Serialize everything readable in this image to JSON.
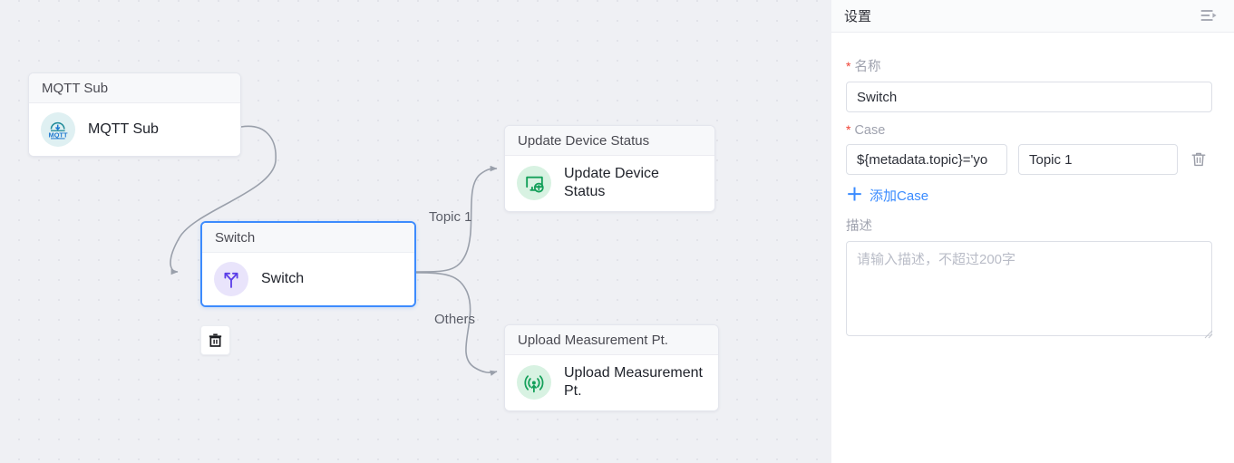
{
  "canvas": {
    "nodes": [
      {
        "id": "mqtt-sub",
        "header": "MQTT Sub",
        "label": "MQTT Sub",
        "icon": "mqtt-sub-icon",
        "icon_color": "#1f8a99",
        "icon_bg": "#dff0f2",
        "selected": false
      },
      {
        "id": "switch",
        "header": "Switch",
        "label": "Switch",
        "icon": "switch-branch-icon",
        "icon_color": "#5b3ee8",
        "icon_bg": "#e9e4fb",
        "selected": true
      },
      {
        "id": "update-device-status",
        "header": "Update Device Status",
        "label": "Update Device Status",
        "icon": "update-device-status-icon",
        "icon_color": "#14a05a",
        "icon_bg": "#d8f2e2",
        "selected": false
      },
      {
        "id": "upload-measurement-pt",
        "header": "Upload Measurement Pt.",
        "label": "Upload Measurement Pt.",
        "icon": "upload-measurement-icon",
        "icon_color": "#14a05a",
        "icon_bg": "#d8f2e2",
        "selected": false
      }
    ],
    "edge_labels": {
      "topic1": "Topic 1",
      "others": "Others"
    },
    "delete_node_tooltip": "delete",
    "edge_color": "#9aa0ab",
    "selected_border_color": "#3d8bfd"
  },
  "panel": {
    "title": "设置",
    "collapse_icon": "collapse-panel-icon",
    "name_field": {
      "label": "名称",
      "required": true,
      "value": "Switch",
      "placeholder": ""
    },
    "case_field": {
      "label": "Case",
      "required": true,
      "rows": [
        {
          "expression": "${metadata.topic}='yo",
          "name": "Topic 1",
          "delete_icon": "trash-icon"
        }
      ],
      "add_label": "添加Case",
      "add_icon": "plus-icon"
    },
    "description_field": {
      "label": "描述",
      "required": false,
      "value": "",
      "placeholder": "请输入描述，不超过200字"
    },
    "link_color": "#3a8bff",
    "required_color": "#f04134"
  }
}
